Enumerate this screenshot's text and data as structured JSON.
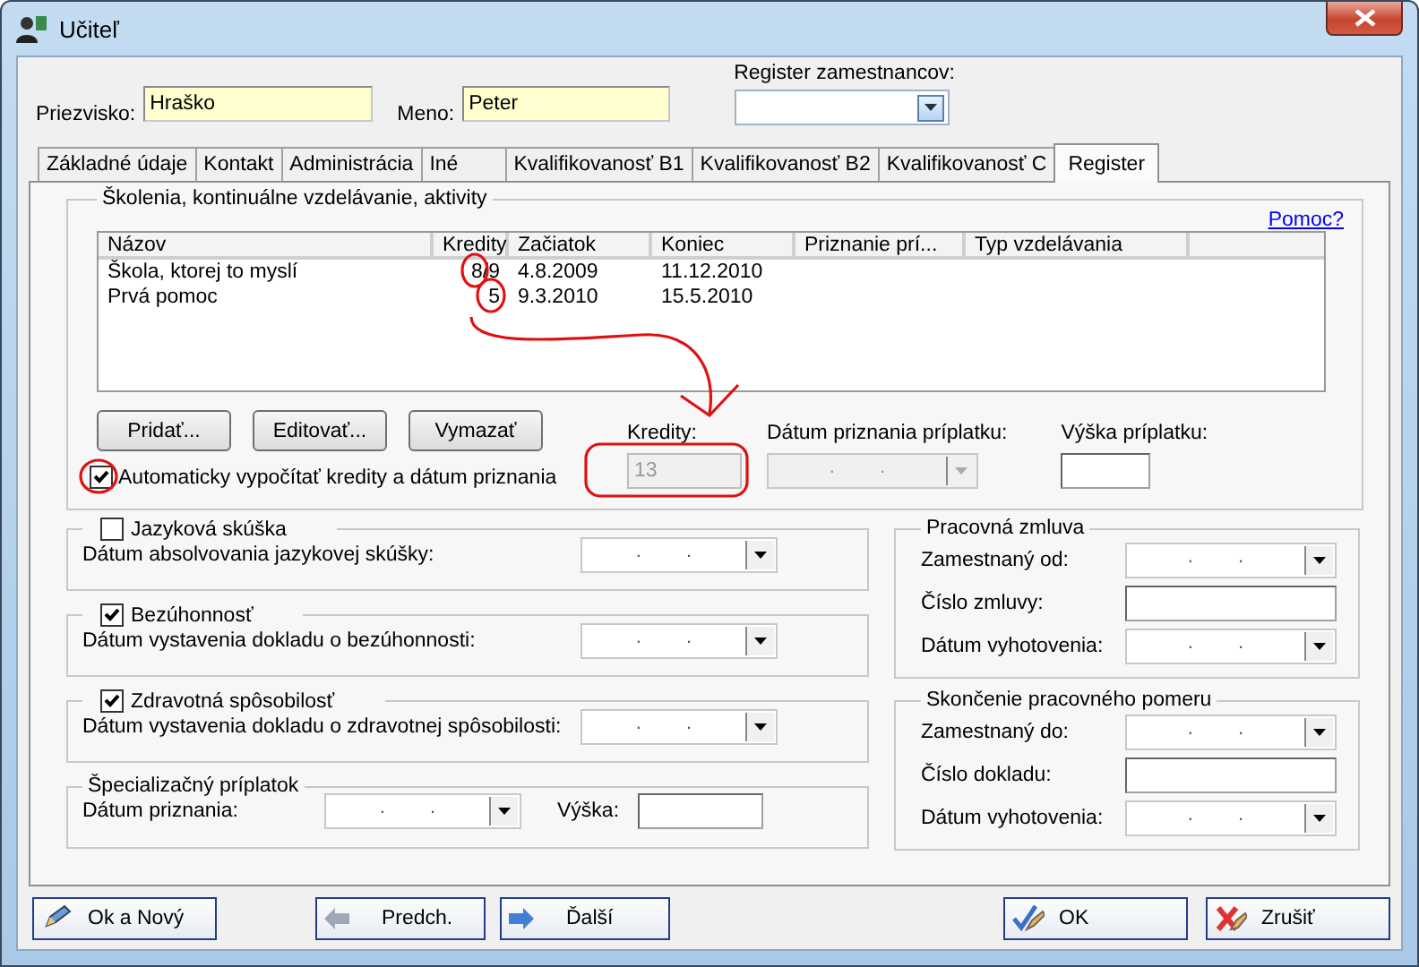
{
  "window": {
    "title": "Učiteľ"
  },
  "header": {
    "surname": {
      "label": "Priezvisko:",
      "value": "Hraško"
    },
    "name": {
      "label": "Meno:",
      "value": "Peter"
    },
    "register": {
      "label": "Register zamestnancov:"
    }
  },
  "tabs": [
    {
      "label": "Základné údaje",
      "selected": false
    },
    {
      "label": "Kontakt",
      "selected": false
    },
    {
      "label": "Administrácia",
      "selected": false
    },
    {
      "label": "Iné",
      "selected": false
    },
    {
      "label": "Kvalifikovanosť B1",
      "selected": false
    },
    {
      "label": "Kvalifikovanosť B2",
      "selected": false
    },
    {
      "label": "Kvalifikovanosť C",
      "selected": false
    },
    {
      "label": "Register",
      "selected": true
    }
  ],
  "trainings": {
    "title": "Školenia, kontinuálne vzdelávanie, aktivity",
    "help_link": "Pomoc?",
    "columns": [
      "Názov",
      "Kredity",
      "Začiatok",
      "Koniec",
      "Priznanie prí...",
      "Typ vzdelávania"
    ],
    "rows": [
      [
        "Škola, ktorej to myslí",
        "8/9",
        "4.8.2009",
        "11.12.2010"
      ],
      [
        "Prvá pomoc",
        "5",
        "9.3.2010",
        "15.5.2010"
      ]
    ],
    "buttons": [
      "Pridať...",
      "Editovať...",
      "Vymazať"
    ],
    "auto_calc": {
      "label": "Automaticky vypočítať kredity a dátum priznania",
      "checked": true
    },
    "credits": {
      "label": "Kredity:",
      "value": "13",
      "disabled": true
    },
    "allowance_date": {
      "label": "Dátum priznania príplatku:",
      "value": ". .",
      "disabled": true
    },
    "allowance_amount": {
      "label": "Výška príplatku:"
    }
  },
  "checks": [
    {
      "title": "Jazyková skúška",
      "checked": false,
      "field_label": "Dátum absolvovania jazykovej skúšky:",
      "value": ". ."
    },
    {
      "title": "Bezúhonnosť",
      "checked": true,
      "field_label": "Dátum vystavenia dokladu o bezúhonnosti:",
      "value": ". ."
    },
    {
      "title": "Zdravotná spôsobilosť",
      "checked": true,
      "field_label": "Dátum vystavenia dokladu o zdravotnej spôsobilosti:",
      "value": ". ."
    }
  ],
  "special": {
    "title": "Špecializačný príplatok",
    "date_label": "Dátum priznania:",
    "date_value": ". .",
    "amount_label": "Výška:"
  },
  "right_groups": [
    {
      "title": "Pracovná zmluva",
      "fields": [
        {
          "kind": "date",
          "label": "Zamestnaný od:",
          "value": ". ."
        },
        {
          "kind": "text",
          "label": "Číslo zmluvy:"
        },
        {
          "kind": "date",
          "label": "Dátum vyhotovenia:",
          "value": ". ."
        }
      ]
    },
    {
      "title": "Skončenie pracovného pomeru",
      "fields": [
        {
          "kind": "date",
          "label": "Zamestnaný do:",
          "value": ". ."
        },
        {
          "kind": "text",
          "label": "Číslo dokladu:"
        },
        {
          "kind": "date",
          "label": "Dátum vyhotovenia:",
          "value": ". ."
        }
      ]
    }
  ],
  "footer_buttons": [
    {
      "label": "Ok a Nový",
      "kind": "edit"
    },
    {
      "label": "Predch.",
      "kind": "prev"
    },
    {
      "label": "Ďalší",
      "kind": "next"
    },
    {
      "label": "OK",
      "kind": "ok"
    },
    {
      "label": "Zrušiť",
      "kind": "cancel"
    }
  ]
}
